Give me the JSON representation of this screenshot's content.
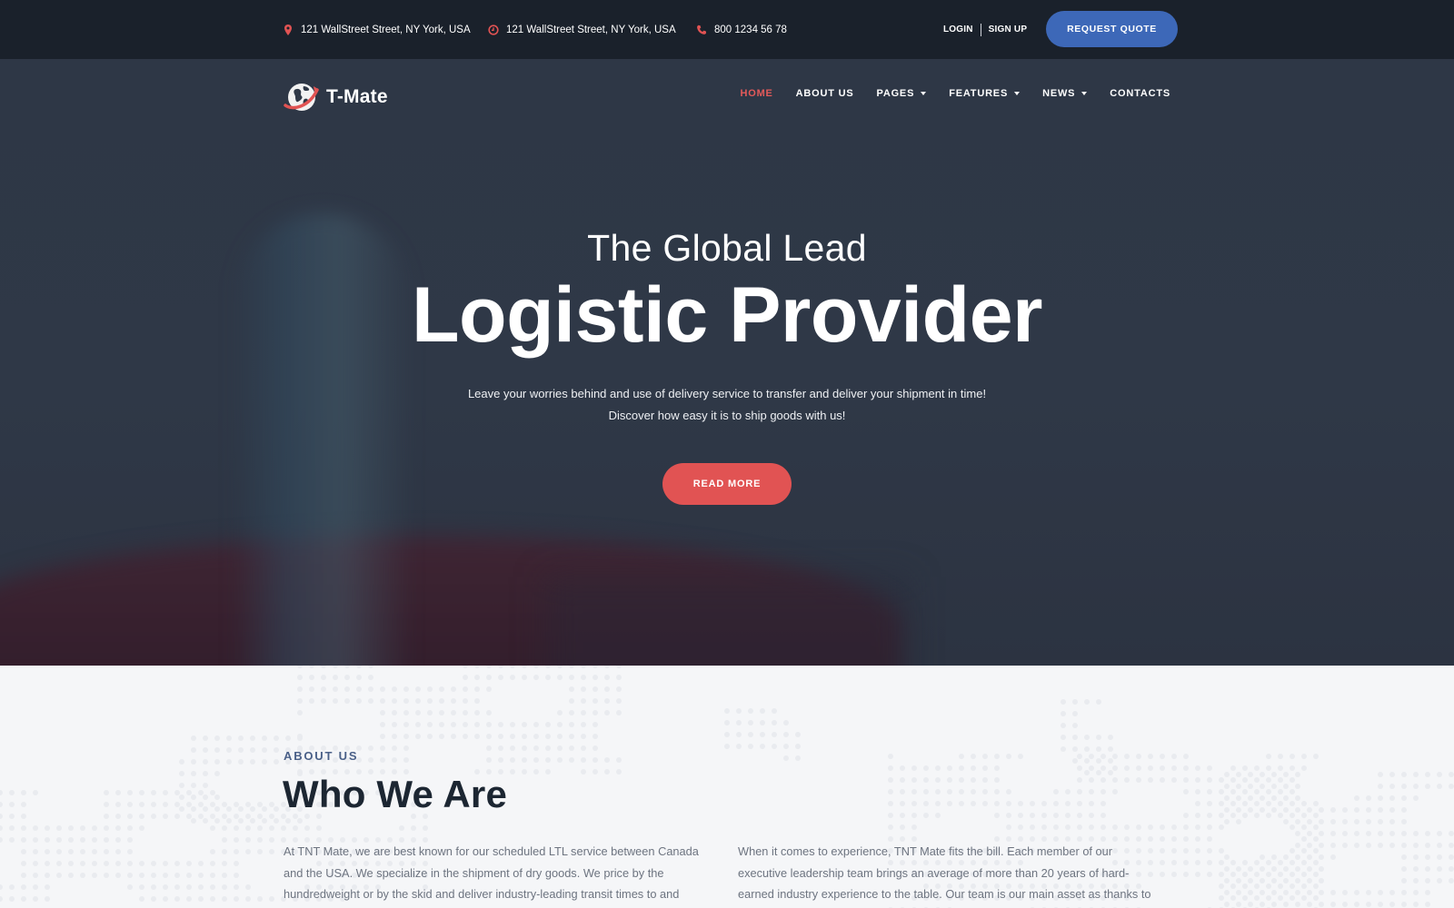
{
  "topbar": {
    "contacts": [
      {
        "icon": "map-pin-icon",
        "text": "121 WallStreet Street, NY York, USA"
      },
      {
        "icon": "clock-icon",
        "text": "121 WallStreet Street, NY York, USA"
      },
      {
        "icon": "phone-icon",
        "text": "800 1234 56 78"
      }
    ],
    "login_label": "LOGIN",
    "signup_label": "SIGN UP",
    "request_quote_label": "REQUEST QUOTE"
  },
  "brand": {
    "name": "T-Mate",
    "logo_icon": "globe-swoosh-icon"
  },
  "nav": {
    "items": [
      {
        "label": "HOME",
        "active": true,
        "dropdown": false
      },
      {
        "label": "ABOUT US",
        "active": false,
        "dropdown": false
      },
      {
        "label": "PAGES",
        "active": false,
        "dropdown": true
      },
      {
        "label": "FEATURES",
        "active": false,
        "dropdown": true
      },
      {
        "label": "NEWS",
        "active": false,
        "dropdown": true
      },
      {
        "label": "CONTACTS",
        "active": false,
        "dropdown": false
      }
    ]
  },
  "hero": {
    "subtitle": "The Global Lead",
    "title": "Logistic Provider",
    "text_line1": "Leave your worries behind and use of delivery service to transfer and deliver your shipment in time!",
    "text_line2": "Discover how easy it is to ship goods with us!",
    "cta_label": "READ MORE"
  },
  "about": {
    "eyebrow": "ABOUT US",
    "heading": "Who We Are",
    "col1": "At TNT Mate, we are best known for our scheduled LTL service between Canada and the USA. We specialize in the shipment of dry goods. We price by the hundredweight or by the skid and deliver industry-leading transit times to and",
    "col2": "When it comes to experience, TNT Mate fits the bill. Each member of our executive leadership team brings an average of more than 20 years of hard-earned industry experience to the table. Our team is our main asset as thanks to"
  },
  "colors": {
    "topbar_bg": "#1a212b",
    "hero_bg": "#2f3847",
    "accent_red": "#e15353",
    "accent_blue": "#3d68b8",
    "eyebrow": "#4a6088",
    "heading_dark": "#1c2632"
  }
}
